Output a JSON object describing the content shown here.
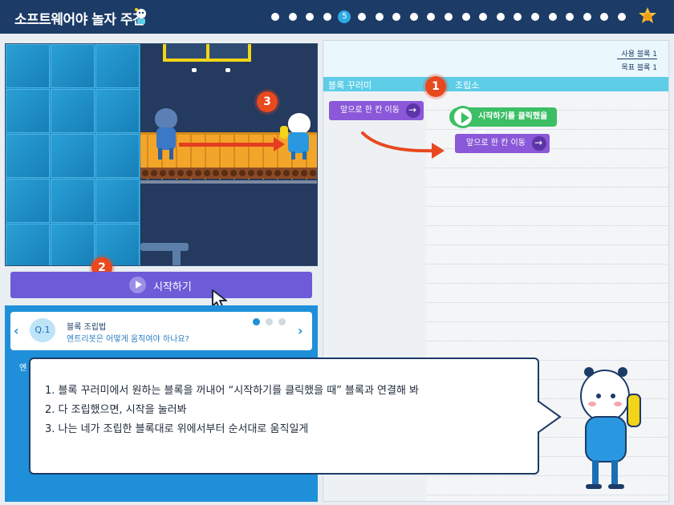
{
  "header": {
    "title": "소프트웨어야 놀자 주간",
    "pagination": {
      "total": 21,
      "current": 5,
      "current_label": "5"
    }
  },
  "game": {
    "badges": {
      "two": "2",
      "three": "3",
      "one": "1"
    }
  },
  "start_button": {
    "label": "시작하기"
  },
  "question": {
    "number": "Q.1",
    "title": "블록 조립법",
    "subtitle": "엔트리봇은 어떻게 움직여야 하나요?",
    "partial_text": "엔",
    "page_dots": 3,
    "page_active": 1
  },
  "editor": {
    "used_blocks": "사용 블록 1",
    "target_blocks": "목표 블록 1",
    "palette_title": "블록 꾸러미",
    "workspace_title": "조립소",
    "palette_block": "앞으로 한 칸 이동",
    "start_block": "시작하기를 클릭했을 때",
    "workspace_block": "앞으로 한 칸 이동"
  },
  "speech": {
    "lines": [
      "1. 블록 꾸러미에서 원하는 블록을 꺼내어 “시작하기를 클릭했을 때” 블록과 연결해 봐",
      "2. 다 조립했으면, 시작을 눌러봐",
      "3. 나는 네가 조립한 블록대로 위에서부터 순서대로 움직일게"
    ]
  },
  "colors": {
    "header_bg": "#1c3b66",
    "accent_blue": "#1f8fd9",
    "start_purple": "#6d5bd8",
    "block_purple": "#8a58d8",
    "block_green": "#3cbf65",
    "badge_red": "#e8491f"
  },
  "icons": [
    "entry-logo-icon",
    "trophy-icon",
    "play-icon",
    "cursor-icon",
    "arrow-right-icon",
    "chevron-left-icon",
    "chevron-right-icon"
  ]
}
